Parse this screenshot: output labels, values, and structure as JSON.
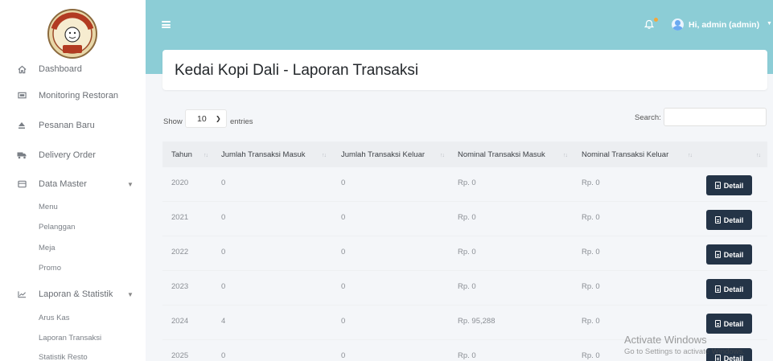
{
  "sidebar": {
    "logo_text": "KEDAI KOPI DALI",
    "items": [
      {
        "label": "Dashboard",
        "icon": "home-icon"
      },
      {
        "label": "Monitoring Restoran",
        "icon": "monitor-icon"
      },
      {
        "label": "Pesanan Baru",
        "icon": "eject-icon"
      },
      {
        "label": "Delivery Order",
        "icon": "truck-icon"
      },
      {
        "label": "Data Master",
        "icon": "database-icon"
      },
      {
        "label": "Laporan & Statistik",
        "icon": "chart-icon"
      }
    ],
    "data_master_sub": [
      "Menu",
      "Pelanggan",
      "Meja",
      "Promo"
    ],
    "laporan_sub": [
      "Arus Kas",
      "Laporan Transaksi",
      "Statistik Resto"
    ]
  },
  "topbar": {
    "user_label": "Hi, admin (admin)",
    "bell_icon": "bell-icon",
    "menu_icon": "hamburger-icon"
  },
  "page": {
    "title": "Kedai Kopi Dali - Laporan Transaksi"
  },
  "table_controls": {
    "show_label": "Show",
    "page_length": "10",
    "entries_label": "entries",
    "search_label": "Search:"
  },
  "table": {
    "headers": [
      "Tahun",
      "Jumlah Transaksi Masuk",
      "Jumlah Transaksi Keluar",
      "Nominal Transaksi Masuk",
      "Nominal Transaksi Keluar",
      ""
    ],
    "rows": [
      {
        "tahun": "2020",
        "masuk": "0",
        "keluar": "0",
        "nominal_masuk": "Rp. 0",
        "nominal_keluar": "Rp. 0",
        "action": "Detail"
      },
      {
        "tahun": "2021",
        "masuk": "0",
        "keluar": "0",
        "nominal_masuk": "Rp. 0",
        "nominal_keluar": "Rp. 0",
        "action": "Detail"
      },
      {
        "tahun": "2022",
        "masuk": "0",
        "keluar": "0",
        "nominal_masuk": "Rp. 0",
        "nominal_keluar": "Rp. 0",
        "action": "Detail"
      },
      {
        "tahun": "2023",
        "masuk": "0",
        "keluar": "0",
        "nominal_masuk": "Rp. 0",
        "nominal_keluar": "Rp. 0",
        "action": "Detail"
      },
      {
        "tahun": "2024",
        "masuk": "4",
        "keluar": "0",
        "nominal_masuk": "Rp. 95,288",
        "nominal_keluar": "Rp. 0",
        "action": "Detail"
      },
      {
        "tahun": "2025",
        "masuk": "0",
        "keluar": "0",
        "nominal_masuk": "Rp. 0",
        "nominal_keluar": "Rp. 0",
        "action": "Detail"
      }
    ]
  },
  "watermark": {
    "line1": "Activate Windows",
    "line2": "Go to Settings to activate Windows."
  },
  "colors": {
    "topbar": "#8ccdd6",
    "detail_button": "#243447",
    "background": "#f4f6f9"
  }
}
